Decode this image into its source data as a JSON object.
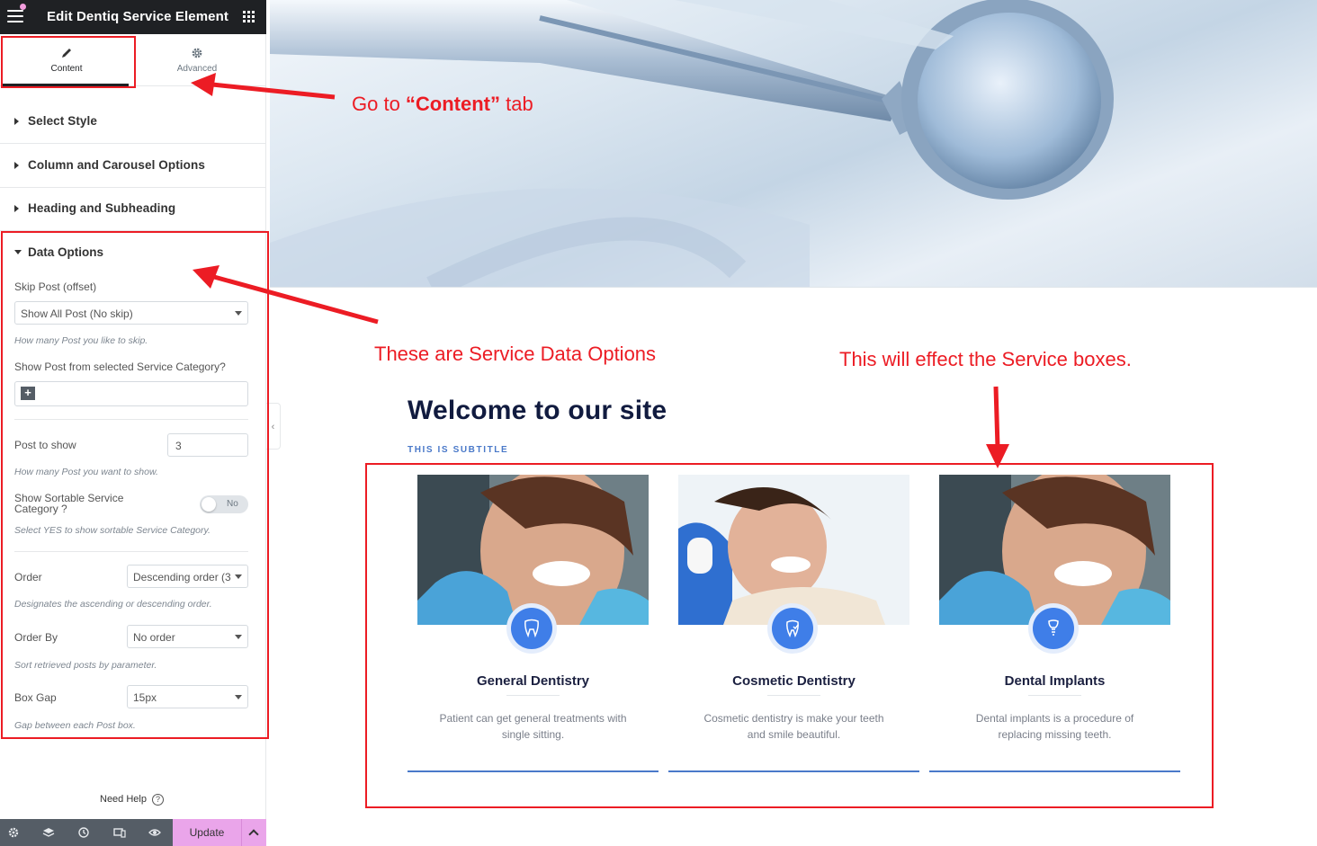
{
  "editor": {
    "title": "Edit Dentiq Service Element",
    "tabs": [
      {
        "label": "Content",
        "icon": "pencil-icon",
        "active": true
      },
      {
        "label": "Advanced",
        "icon": "gear-icon",
        "active": false
      }
    ],
    "sections": [
      {
        "label": "Select Style"
      },
      {
        "label": "Column and Carousel Options"
      },
      {
        "label": "Heading and Subheading"
      }
    ],
    "data_options": {
      "title": "Data Options",
      "skip_post": {
        "label": "Skip Post (offset)",
        "value": "Show All Post (No skip)",
        "help": "How many Post you like to skip."
      },
      "category": {
        "label": "Show Post from selected Service Category?"
      },
      "post_to_show": {
        "label": "Post to show",
        "value": "3",
        "help": "How many Post you want to show."
      },
      "sortable": {
        "label": "Show Sortable Service Category ?",
        "toggle_text": "No",
        "enabled": false,
        "help": "Select YES to show sortable Service Category."
      },
      "order": {
        "label": "Order",
        "value": "Descending order (3",
        "help": "Designates the ascending or descending order."
      },
      "order_by": {
        "label": "Order By",
        "value": "No order",
        "help": "Sort retrieved posts by parameter."
      },
      "box_gap": {
        "label": "Box Gap",
        "value": "15px",
        "help": "Gap between each Post box."
      }
    },
    "need_help": "Need Help",
    "update_label": "Update"
  },
  "preview": {
    "heading": "Welcome to our site",
    "subtitle": "THIS IS SUBTITLE",
    "services": [
      {
        "title": "General Dentistry",
        "desc": "Patient can get general treatments with single sitting.",
        "icon": "tooth-tools-icon"
      },
      {
        "title": "Cosmetic Dentistry",
        "desc": "Cosmetic dentistry is make your teeth and smile beautiful.",
        "icon": "tooth-shield-icon"
      },
      {
        "title": "Dental Implants",
        "desc": "Dental implants is a procedure of replacing missing teeth.",
        "icon": "implant-icon"
      }
    ]
  },
  "annotations": {
    "content_tab_note": {
      "prefix": "Go  to ",
      "bold": "“Content”",
      "suffix": " tab"
    },
    "data_options_note": "These are Service Data Options",
    "boxes_note": "This will effect the Service boxes."
  },
  "colors": {
    "topbar": "#1f2124",
    "accent_red": "#ec1c24",
    "update_button": "#eaa5ea",
    "service_blue": "#3f7ee8",
    "heading_navy": "#111b3f"
  }
}
